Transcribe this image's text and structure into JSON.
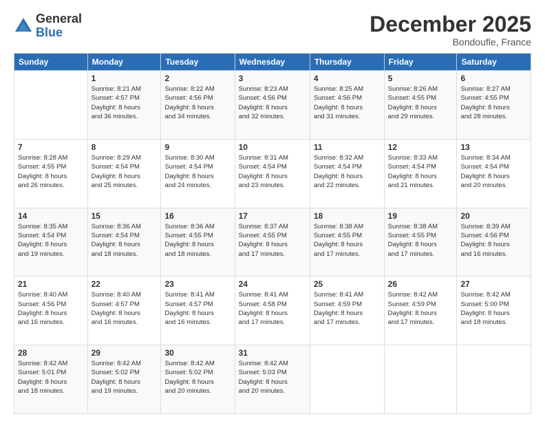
{
  "logo": {
    "general": "General",
    "blue": "Blue"
  },
  "header": {
    "month": "December 2025",
    "location": "Bondoufle, France"
  },
  "weekdays": [
    "Sunday",
    "Monday",
    "Tuesday",
    "Wednesday",
    "Thursday",
    "Friday",
    "Saturday"
  ],
  "weeks": [
    [
      {
        "day": "",
        "info": ""
      },
      {
        "day": "1",
        "info": "Sunrise: 8:21 AM\nSunset: 4:57 PM\nDaylight: 8 hours\nand 36 minutes."
      },
      {
        "day": "2",
        "info": "Sunrise: 8:22 AM\nSunset: 4:56 PM\nDaylight: 8 hours\nand 34 minutes."
      },
      {
        "day": "3",
        "info": "Sunrise: 8:23 AM\nSunset: 4:56 PM\nDaylight: 8 hours\nand 32 minutes."
      },
      {
        "day": "4",
        "info": "Sunrise: 8:25 AM\nSunset: 4:56 PM\nDaylight: 8 hours\nand 31 minutes."
      },
      {
        "day": "5",
        "info": "Sunrise: 8:26 AM\nSunset: 4:55 PM\nDaylight: 8 hours\nand 29 minutes."
      },
      {
        "day": "6",
        "info": "Sunrise: 8:27 AM\nSunset: 4:55 PM\nDaylight: 8 hours\nand 28 minutes."
      }
    ],
    [
      {
        "day": "7",
        "info": "Sunrise: 8:28 AM\nSunset: 4:55 PM\nDaylight: 8 hours\nand 26 minutes."
      },
      {
        "day": "8",
        "info": "Sunrise: 8:29 AM\nSunset: 4:54 PM\nDaylight: 8 hours\nand 25 minutes."
      },
      {
        "day": "9",
        "info": "Sunrise: 8:30 AM\nSunset: 4:54 PM\nDaylight: 8 hours\nand 24 minutes."
      },
      {
        "day": "10",
        "info": "Sunrise: 8:31 AM\nSunset: 4:54 PM\nDaylight: 8 hours\nand 23 minutes."
      },
      {
        "day": "11",
        "info": "Sunrise: 8:32 AM\nSunset: 4:54 PM\nDaylight: 8 hours\nand 22 minutes."
      },
      {
        "day": "12",
        "info": "Sunrise: 8:33 AM\nSunset: 4:54 PM\nDaylight: 8 hours\nand 21 minutes."
      },
      {
        "day": "13",
        "info": "Sunrise: 8:34 AM\nSunset: 4:54 PM\nDaylight: 8 hours\nand 20 minutes."
      }
    ],
    [
      {
        "day": "14",
        "info": "Sunrise: 8:35 AM\nSunset: 4:54 PM\nDaylight: 8 hours\nand 19 minutes."
      },
      {
        "day": "15",
        "info": "Sunrise: 8:36 AM\nSunset: 4:54 PM\nDaylight: 8 hours\nand 18 minutes."
      },
      {
        "day": "16",
        "info": "Sunrise: 8:36 AM\nSunset: 4:55 PM\nDaylight: 8 hours\nand 18 minutes."
      },
      {
        "day": "17",
        "info": "Sunrise: 8:37 AM\nSunset: 4:55 PM\nDaylight: 8 hours\nand 17 minutes."
      },
      {
        "day": "18",
        "info": "Sunrise: 8:38 AM\nSunset: 4:55 PM\nDaylight: 8 hours\nand 17 minutes."
      },
      {
        "day": "19",
        "info": "Sunrise: 8:38 AM\nSunset: 4:55 PM\nDaylight: 8 hours\nand 17 minutes."
      },
      {
        "day": "20",
        "info": "Sunrise: 8:39 AM\nSunset: 4:56 PM\nDaylight: 8 hours\nand 16 minutes."
      }
    ],
    [
      {
        "day": "21",
        "info": "Sunrise: 8:40 AM\nSunset: 4:56 PM\nDaylight: 8 hours\nand 16 minutes."
      },
      {
        "day": "22",
        "info": "Sunrise: 8:40 AM\nSunset: 4:57 PM\nDaylight: 8 hours\nand 16 minutes."
      },
      {
        "day": "23",
        "info": "Sunrise: 8:41 AM\nSunset: 4:57 PM\nDaylight: 8 hours\nand 16 minutes."
      },
      {
        "day": "24",
        "info": "Sunrise: 8:41 AM\nSunset: 4:58 PM\nDaylight: 8 hours\nand 17 minutes."
      },
      {
        "day": "25",
        "info": "Sunrise: 8:41 AM\nSunset: 4:59 PM\nDaylight: 8 hours\nand 17 minutes."
      },
      {
        "day": "26",
        "info": "Sunrise: 8:42 AM\nSunset: 4:59 PM\nDaylight: 8 hours\nand 17 minutes."
      },
      {
        "day": "27",
        "info": "Sunrise: 8:42 AM\nSunset: 5:00 PM\nDaylight: 8 hours\nand 18 minutes."
      }
    ],
    [
      {
        "day": "28",
        "info": "Sunrise: 8:42 AM\nSunset: 5:01 PM\nDaylight: 8 hours\nand 18 minutes."
      },
      {
        "day": "29",
        "info": "Sunrise: 8:42 AM\nSunset: 5:02 PM\nDaylight: 8 hours\nand 19 minutes."
      },
      {
        "day": "30",
        "info": "Sunrise: 8:42 AM\nSunset: 5:02 PM\nDaylight: 8 hours\nand 20 minutes."
      },
      {
        "day": "31",
        "info": "Sunrise: 8:42 AM\nSunset: 5:03 PM\nDaylight: 8 hours\nand 20 minutes."
      },
      {
        "day": "",
        "info": ""
      },
      {
        "day": "",
        "info": ""
      },
      {
        "day": "",
        "info": ""
      }
    ]
  ]
}
